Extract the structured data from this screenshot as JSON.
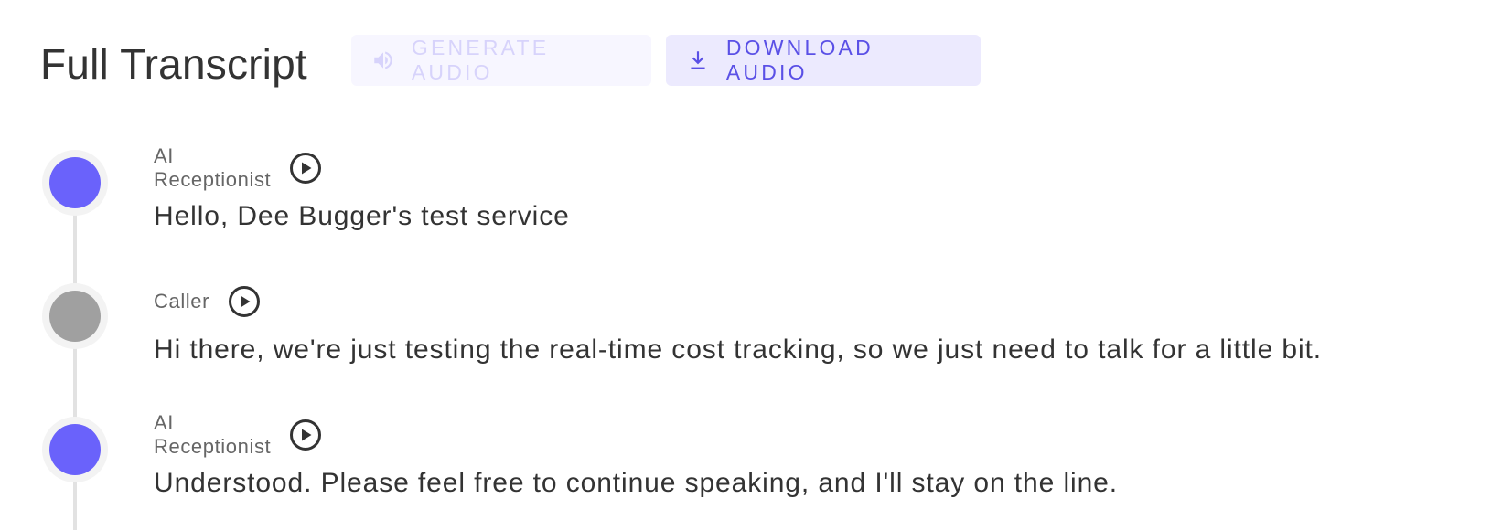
{
  "header": {
    "title": "Full Transcript",
    "generate_audio_label": "GENERATE AUDIO",
    "download_audio_label": "DOWNLOAD AUDIO"
  },
  "colors": {
    "ai_avatar": "#6a62fb",
    "caller_avatar": "#a0a0a0",
    "accent": "#5a50e6",
    "disabled_text": "#d7d3fb"
  },
  "icons": {
    "generate_audio": "speaker-icon",
    "download_audio": "download-icon",
    "play": "play-circle-icon"
  },
  "transcript": [
    {
      "speaker": "AI Receptionist",
      "role": "ai",
      "text": "Hello, Dee Bugger's test service"
    },
    {
      "speaker": "Caller",
      "role": "caller",
      "text": "Hi there, we're just testing the real-time cost tracking, so we just need to talk for a little bit."
    },
    {
      "speaker": "AI Receptionist",
      "role": "ai",
      "text": "Understood. Please feel free to continue speaking, and I'll stay on the line."
    }
  ]
}
